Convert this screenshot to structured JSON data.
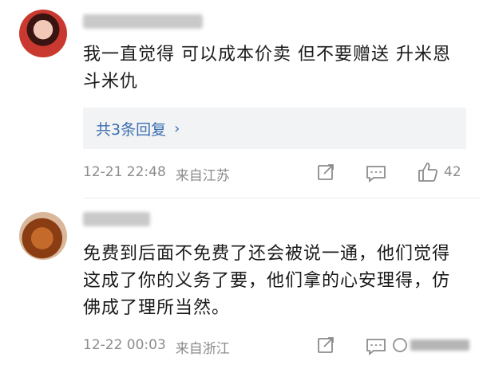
{
  "comments": [
    {
      "text": "我一直觉得 可以成本价卖 但不要赠送 升米恩 斗米仇",
      "replies_label": "共3条回复",
      "replies_chevron": "›",
      "timestamp": "12-21 22:48",
      "location": "来自江苏",
      "likes": "42"
    },
    {
      "text": "免费到后面不免费了还会被说一通，他们觉得这成了你的义务了要，他们拿的心安理得，仿佛成了理所当然。",
      "timestamp": "12-22 00:03",
      "location": "来自浙江"
    }
  ],
  "icons": {
    "share": "share-icon",
    "comment": "comment-icon",
    "like": "thumbs-up-icon"
  },
  "colors": {
    "link": "#3b6fb0",
    "meta": "#8c8c8c",
    "reply_bg": "#f2f3f5"
  }
}
